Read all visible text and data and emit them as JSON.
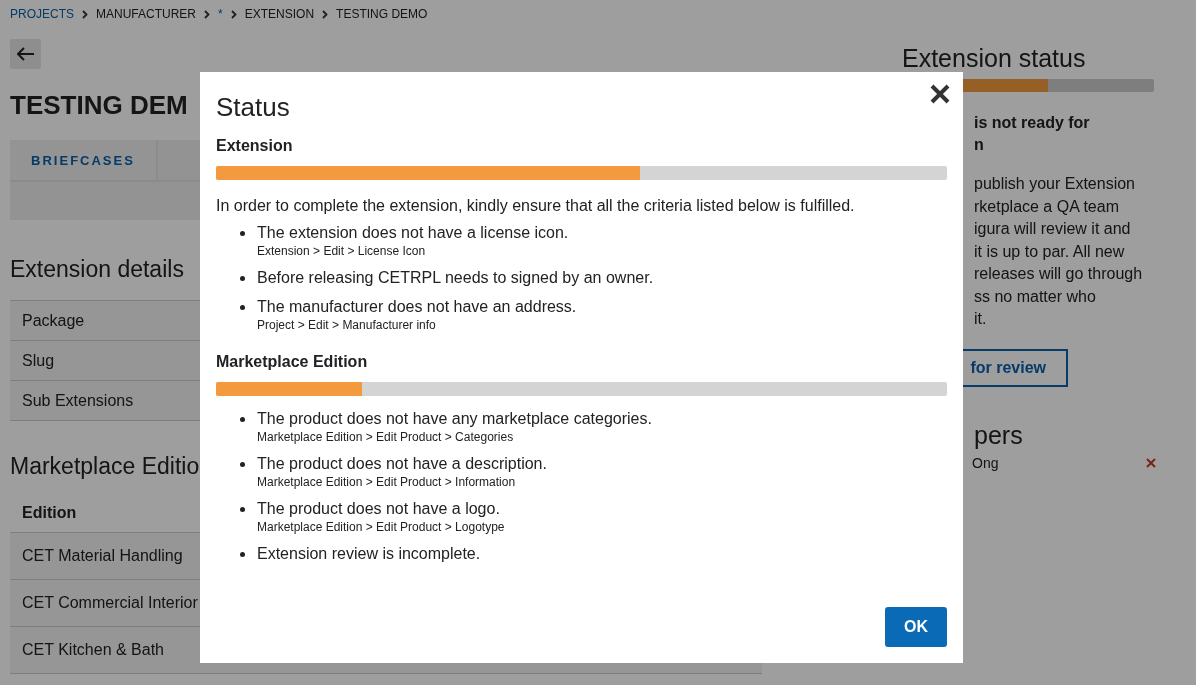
{
  "breadcrumb": [
    {
      "label": "PROJECTS",
      "kind": "link"
    },
    {
      "label": "MANUFACTURER",
      "kind": "text"
    },
    {
      "label": "*",
      "kind": "link"
    },
    {
      "label": "EXTENSION",
      "kind": "text"
    },
    {
      "label": "TESTING DEMO",
      "kind": "text"
    }
  ],
  "title": "TESTING DEM",
  "tabs": [
    {
      "label": "BRIEFCASES",
      "selected": false
    }
  ],
  "extension_details": {
    "heading": "Extension details",
    "rows": [
      "Package",
      "Slug",
      "Sub Extensions"
    ]
  },
  "marketplace_editions": {
    "heading": "Marketplace Editio",
    "column": "Edition",
    "rows": [
      "CET Material Handling",
      "CET Commercial Interior",
      "CET Kitchen & Bath"
    ]
  },
  "extension_status": {
    "heading": "Extension status",
    "level": 0.58,
    "notice_lines": [
      "is not ready for",
      "n"
    ],
    "text_lines": [
      "publish your Extension",
      "rketplace a QA team",
      "igura will review it and",
      "it is up to par. All new",
      "releases will go through",
      "ss no matter who",
      "it."
    ],
    "button": "for review"
  },
  "developers": {
    "heading": "pers",
    "items": [
      {
        "name": "Ong"
      }
    ]
  },
  "dialog": {
    "title": "Status",
    "sections": [
      {
        "heading": "Extension",
        "level": 0.58,
        "intro": "In order to complete the extension, kindly ensure that all the criteria listed below is fulfilled.",
        "items": [
          {
            "text": "The extension does not have a license icon.",
            "path": "Extension > Edit > License Icon"
          },
          {
            "text": "Before releasing CETRPL needs to signed by an owner."
          },
          {
            "text": "The manufacturer does not have an address.",
            "path": "Project > Edit > Manufacturer info"
          }
        ]
      },
      {
        "heading": "Marketplace Edition",
        "level": 0.2,
        "items": [
          {
            "text": "The product does not have any marketplace categories.",
            "path": "Marketplace Edition > Edit Product > Categories"
          },
          {
            "text": "The product does not have a description.",
            "path": "Marketplace Edition > Edit Product > Information"
          },
          {
            "text": "The product does not have a logo.",
            "path": "Marketplace Edition > Edit Product > Logotype"
          },
          {
            "text": "Extension review is incomplete."
          }
        ]
      }
    ],
    "ok_button": "OK"
  }
}
